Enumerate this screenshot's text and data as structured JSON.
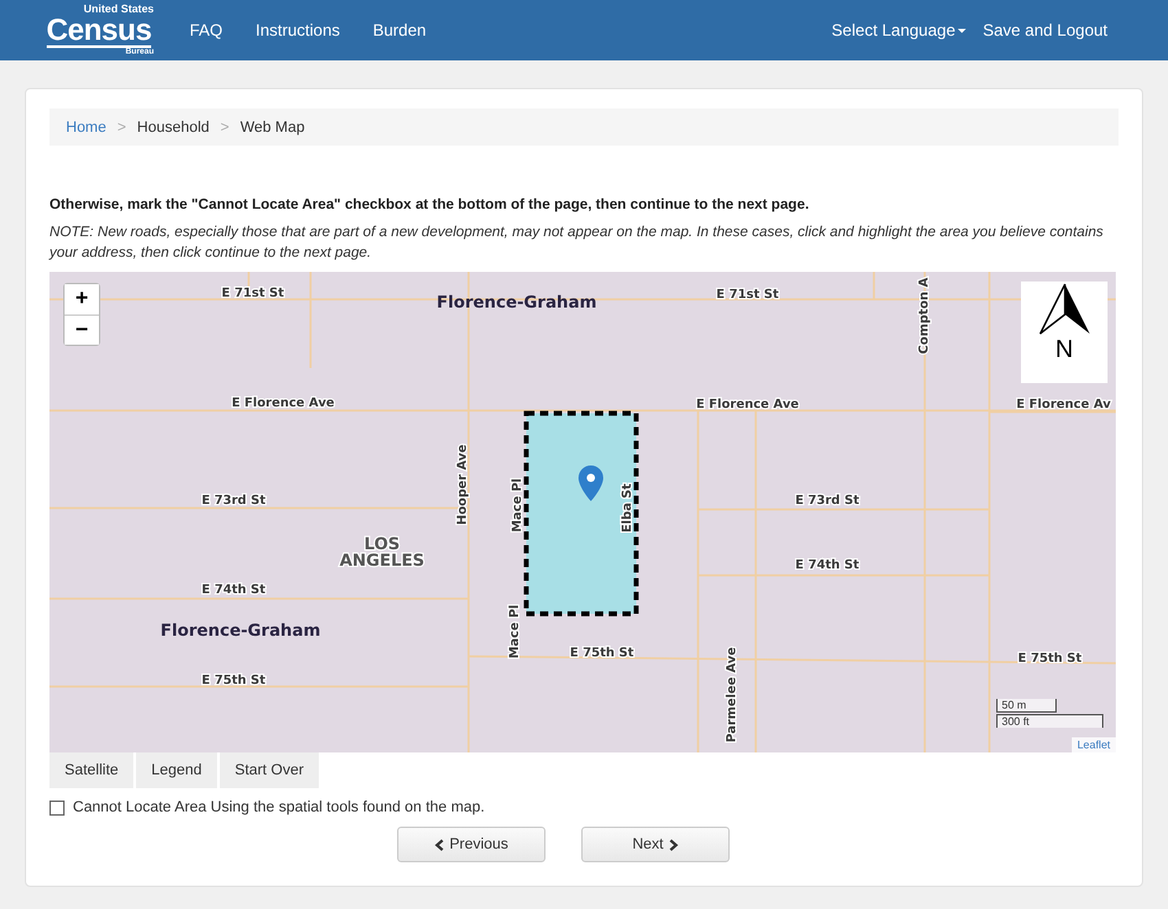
{
  "header": {
    "logo": {
      "top": "United States",
      "main": "Census",
      "bottom": "Bureau"
    },
    "nav": [
      "FAQ",
      "Instructions",
      "Burden"
    ],
    "right": [
      {
        "label": "Select Language",
        "kind": "dropdown"
      },
      {
        "label": "Save and Logout",
        "kind": "link"
      }
    ]
  },
  "breadcrumb": {
    "items": [
      "Home",
      "Household",
      "Web Map"
    ],
    "separator": ">"
  },
  "instruction": "Otherwise, mark the \"Cannot Locate Area\" checkbox at the bottom of the page, then continue to the next page.",
  "note": "NOTE: New roads, especially those that are part of a new development, may not appear on the map. In these cases, click and highlight the area you believe contains your address, then click continue to the next page.",
  "map": {
    "zoom_in": "+",
    "zoom_out": "−",
    "labels": [
      {
        "text": "E 71st St",
        "kind": "street",
        "vertical": false
      },
      {
        "text": "Florence-Graham",
        "kind": "place",
        "vertical": false
      },
      {
        "text": "E 71st St",
        "kind": "street",
        "vertical": false
      },
      {
        "text": "E Florence Ave",
        "kind": "street",
        "vertical": false
      },
      {
        "text": "E Florence Ave",
        "kind": "street",
        "vertical": false
      },
      {
        "text": "E Florence Av",
        "kind": "street",
        "vertical": false
      },
      {
        "text": "E 73rd St",
        "kind": "street",
        "vertical": false
      },
      {
        "text": "E 73rd St",
        "kind": "street",
        "vertical": false
      },
      {
        "text": "LOS ANGELES",
        "kind": "city",
        "vertical": false
      },
      {
        "text": "E 74th St",
        "kind": "street",
        "vertical": false
      },
      {
        "text": "E 74th St",
        "kind": "street",
        "vertical": false
      },
      {
        "text": "Florence-Graham",
        "kind": "place",
        "vertical": false
      },
      {
        "text": "E 75th St",
        "kind": "street",
        "vertical": false
      },
      {
        "text": "E 75th St",
        "kind": "street",
        "vertical": false
      },
      {
        "text": "E 75th St",
        "kind": "street",
        "vertical": false
      },
      {
        "text": "Compton A",
        "kind": "street",
        "vertical": true
      },
      {
        "text": "Hooper Ave",
        "kind": "street",
        "vertical": true
      },
      {
        "text": "Mace Pl",
        "kind": "street",
        "vertical": true
      },
      {
        "text": "Elba St",
        "kind": "street",
        "vertical": true
      },
      {
        "text": "Mace Pl",
        "kind": "street",
        "vertical": true
      },
      {
        "text": "Parmelee Ave",
        "kind": "street",
        "vertical": true
      }
    ],
    "compass": "N",
    "scale": [
      "50 m",
      "300 ft"
    ],
    "attribution": "Leaflet"
  },
  "map_tools": [
    "Satellite",
    "Legend",
    "Start Over"
  ],
  "checkbox": {
    "label": "Cannot Locate Area Using the spatial tools found on the map.",
    "checked": false
  },
  "buttons": [
    {
      "label": "Previous",
      "kind": "prev"
    },
    {
      "label": "Next",
      "kind": "next"
    }
  ]
}
